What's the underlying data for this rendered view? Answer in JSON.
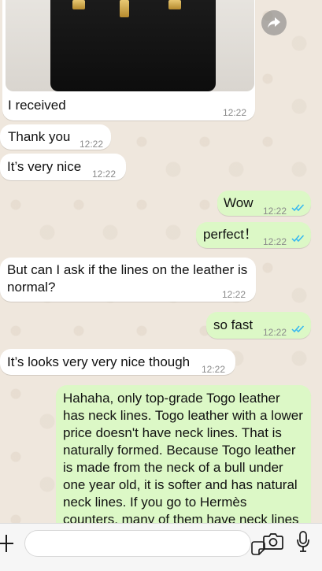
{
  "messages": [
    {
      "text": "I received",
      "time": "12:22",
      "direction": "in"
    },
    {
      "text": "Thank you",
      "time": "12:22",
      "direction": "in"
    },
    {
      "text": "It’s very nice",
      "time": "12:22",
      "direction": "in"
    },
    {
      "text": "Wow",
      "time": "12:22",
      "direction": "out",
      "status": "read"
    },
    {
      "text": "perfect！",
      "time": "12:22",
      "direction": "out",
      "status": "read"
    },
    {
      "text": "But can I ask if the lines on the leather is normal?",
      "time": "12:22",
      "direction": "in"
    },
    {
      "text": "so fast",
      "time": "12:22",
      "direction": "out",
      "status": "read"
    },
    {
      "text": "It’s looks very very nice though",
      "time": "12:22",
      "direction": "in"
    },
    {
      "text": "Hahaha, only top-grade Togo leather has neck lines. Togo leather with a lower price doesn't have neck lines. That is naturally formed. Because Togo leather is made from the neck of a bull under one year old, it is softer and has natural neck lines. If you go to Hermès counters, many of them have neck lines",
      "direction": "out"
    }
  ],
  "composer": {
    "message_value": ""
  },
  "colors": {
    "incoming": "#ffffff",
    "outgoing": "#dcf8c6",
    "read_ticks": "#34b7f1",
    "background": "#efe7dd"
  }
}
